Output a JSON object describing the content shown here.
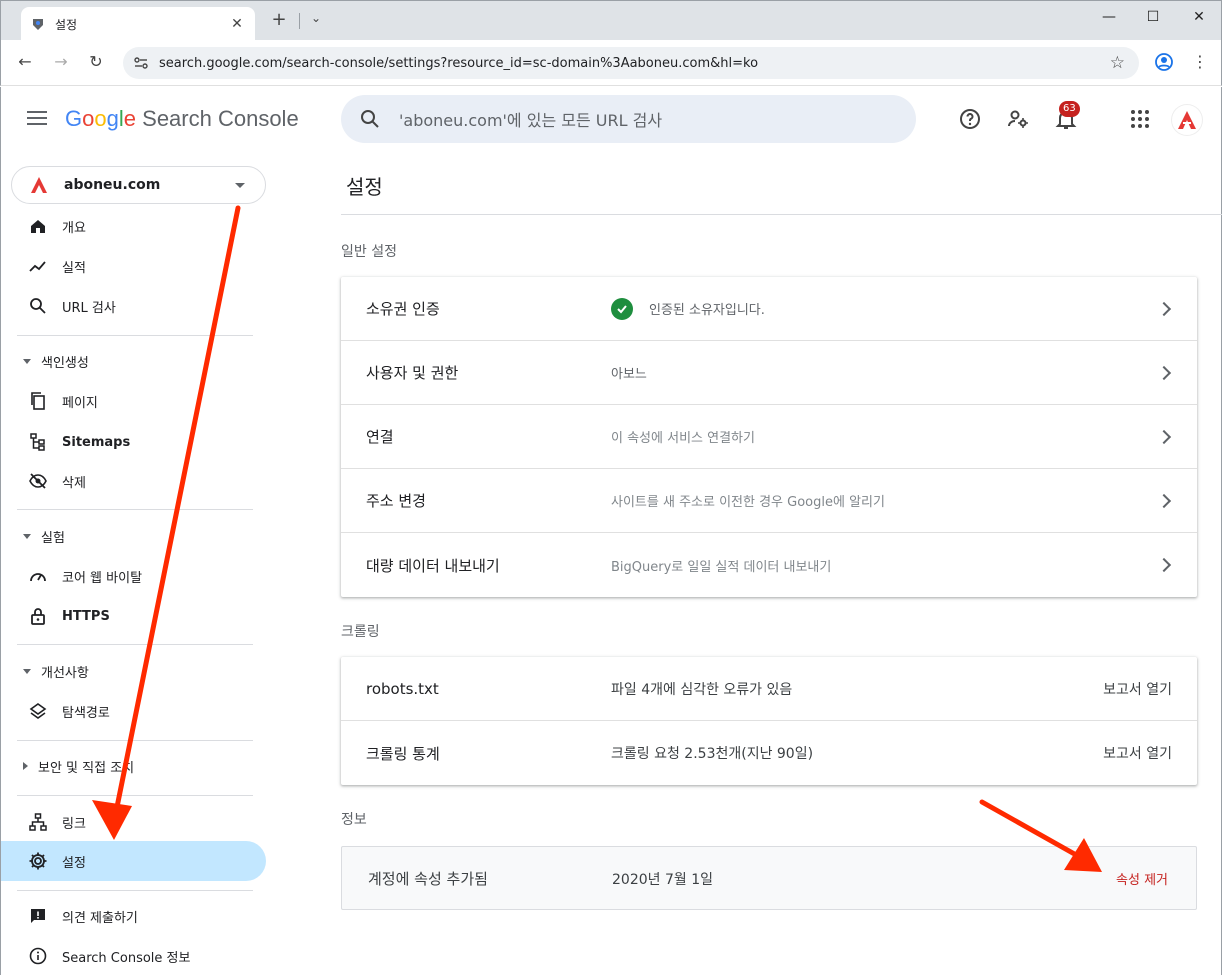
{
  "browser": {
    "tab_title": "설정",
    "url": "search.google.com/search-console/settings?resource_id=sc-domain%3Aaboneu.com&hl=ko"
  },
  "header": {
    "logo_google": [
      "G",
      "o",
      "o",
      "g",
      "l",
      "e"
    ],
    "logo_product": "Search Console",
    "search_placeholder": "'aboneu.com'에 있는 모든 URL 검사",
    "notification_count": "63"
  },
  "sidebar": {
    "property": "aboneu.com",
    "items": [
      {
        "label": "개요",
        "icon": "home-icon"
      },
      {
        "label": "실적",
        "icon": "trending-up-icon"
      },
      {
        "label": "URL 검사",
        "icon": "search-icon"
      }
    ],
    "section_indexing": {
      "label": "색인생성",
      "items": [
        {
          "label": "페이지",
          "icon": "pages-icon"
        },
        {
          "label": "Sitemaps",
          "icon": "sitemap-icon"
        },
        {
          "label": "삭제",
          "icon": "hidden-eye-icon"
        }
      ]
    },
    "section_experience": {
      "label": "실험",
      "items": [
        {
          "label": "코어 웹 바이탈",
          "icon": "speed-gauge-icon"
        },
        {
          "label": "HTTPS",
          "icon": "lock-icon"
        }
      ]
    },
    "section_enhancements": {
      "label": "개선사항",
      "items": [
        {
          "label": "탐색경로",
          "icon": "layers-icon"
        }
      ]
    },
    "section_security": {
      "label": "보안 및 직접 조치"
    },
    "links": {
      "label": "링크",
      "icon": "network-icon"
    },
    "settings": {
      "label": "설정",
      "icon": "gear-icon"
    },
    "feedback": {
      "label": "의견 제출하기",
      "icon": "feedback-icon"
    },
    "about": {
      "label": "Search Console 정보",
      "icon": "info-icon"
    }
  },
  "main": {
    "title": "설정",
    "general": {
      "label": "일반 설정",
      "rows": [
        {
          "label": "소유권 인증",
          "value": "인증된 소유자입니다."
        },
        {
          "label": "사용자 및 권한",
          "value": "아보느"
        },
        {
          "label": "연결",
          "value": "이 속성에 서비스 연결하기"
        },
        {
          "label": "주소 변경",
          "value": "사이트를 새 주소로 이전한 경우 Google에 알리기"
        },
        {
          "label": "대량 데이터 내보내기",
          "value": "BigQuery로 일일 실적 데이터 내보내기"
        }
      ]
    },
    "crawling": {
      "label": "크롤링",
      "rows": [
        {
          "label": "robots.txt",
          "value": "파일 4개에 심각한 오류가 있음",
          "action": "보고서 열기"
        },
        {
          "label": "크롤링 통계",
          "value": "크롤링 요청 2.53천개(지난 90일)",
          "action": "보고서 열기"
        }
      ]
    },
    "info": {
      "label": "정보",
      "row_label": "계정에 속성 추가됨",
      "row_value": "2020년 7월 1일",
      "remove_label": "속성 제거"
    }
  },
  "colors": {
    "accent_blue": "#1a73e8",
    "active_nav": "#c2e7ff",
    "danger_red": "#c5221f",
    "annotation_red": "#ff2a00"
  }
}
